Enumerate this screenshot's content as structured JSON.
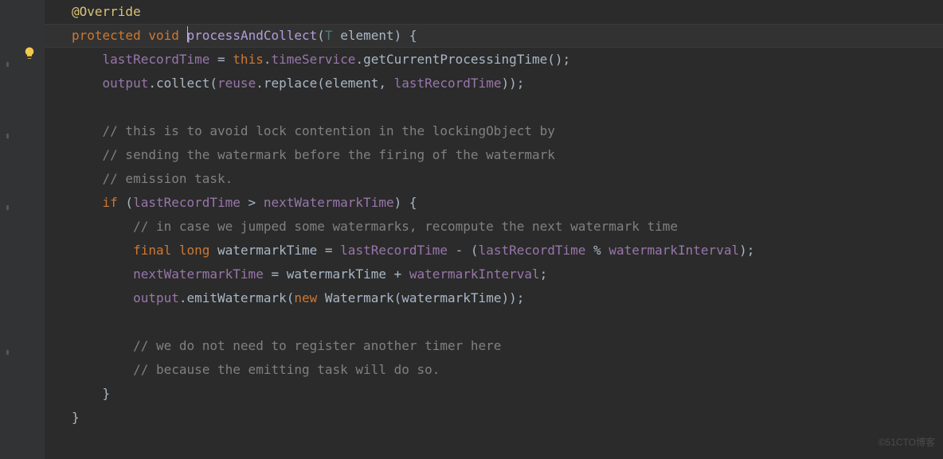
{
  "editor": {
    "annotation": "@Override",
    "sig": {
      "modifier": "protected",
      "ret": "void",
      "name": "processAndCollect",
      "paramType": "T",
      "paramName": "element",
      "close": ") {"
    },
    "l3": {
      "a": "lastRecordTime",
      "b": " = ",
      "c": "this",
      "d": ".",
      "e": "timeService",
      "f": ".getCurrentProcessingTime();"
    },
    "l4": {
      "a": "output",
      "b": ".collect(",
      "c": "reuse",
      "d": ".replace(element, ",
      "e": "lastRecordTime",
      "f": "));"
    },
    "c1": "// this is to avoid lock contention in the lockingObject by",
    "c2": "// sending the watermark before the firing of the watermark",
    "c3": "// emission task.",
    "l9": {
      "a": "if",
      "b": " (",
      "c": "lastRecordTime",
      "d": " > ",
      "e": "nextWatermarkTime",
      "f": ") {"
    },
    "c4": "// in case we jumped some watermarks, recompute the next watermark time",
    "l11": {
      "a": "final",
      "b": " ",
      "c": "long",
      "d": " watermarkTime = ",
      "e": "lastRecordTime",
      "f": " - (",
      "g": "lastRecordTime",
      "h": " % ",
      "i": "watermarkInterval",
      "j": ");"
    },
    "l12": {
      "a": "nextWatermarkTime",
      "b": " = watermarkTime + ",
      "c": "watermarkInterval",
      "d": ";"
    },
    "l13": {
      "a": "output",
      "b": ".emitWatermark(",
      "c": "new",
      "d": " Watermark(watermarkTime));"
    },
    "c5": "// we do not need to register another timer here",
    "c6": "// because the emitting task will do so.",
    "close1": "}",
    "close2": "}"
  },
  "watermark": "©51CTO博客"
}
